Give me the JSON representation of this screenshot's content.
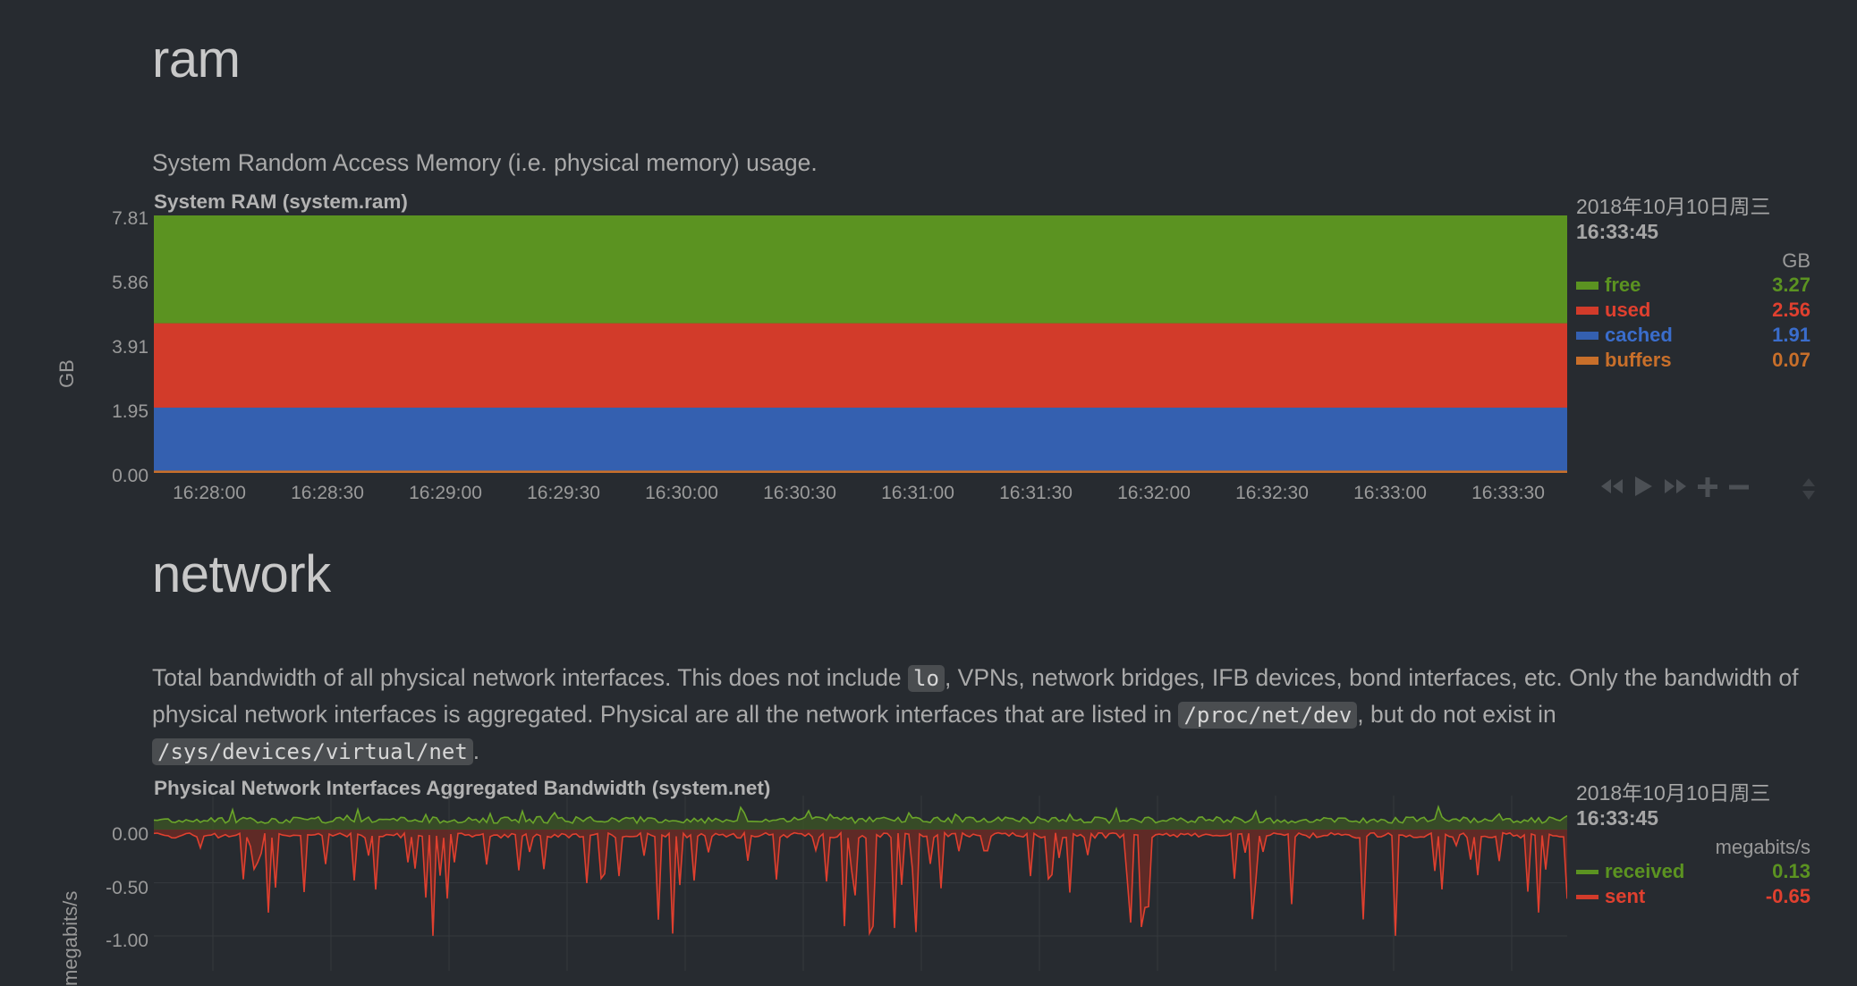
{
  "ram": {
    "heading": "ram",
    "description": "System Random Access Memory (i.e. physical memory) usage.",
    "chart_title": "System RAM (system.ram)",
    "y_unit": "GB",
    "y_ticks": [
      "7.81",
      "5.86",
      "3.91",
      "1.95",
      "0.00"
    ],
    "x_ticks": [
      "16:28:00",
      "16:28:30",
      "16:29:00",
      "16:29:30",
      "16:30:00",
      "16:30:30",
      "16:31:00",
      "16:31:30",
      "16:32:00",
      "16:32:30",
      "16:33:00",
      "16:33:30"
    ],
    "legend": {
      "date": "2018年10月10日周三",
      "time": "16:33:45",
      "units": "GB",
      "items": [
        {
          "name": "free",
          "value": "3.27",
          "color": "#5b9321"
        },
        {
          "name": "used",
          "value": "2.56",
          "color": "#d23b2a"
        },
        {
          "name": "cached",
          "value": "1.91",
          "color": "#3460b0"
        },
        {
          "name": "buffers",
          "value": "0.07",
          "color": "#c86f2a"
        }
      ]
    }
  },
  "network": {
    "heading": "network",
    "desc_part1": "Total bandwidth of all physical network interfaces. This does not include ",
    "code_lo": "lo",
    "desc_part2": ", VPNs, network bridges, IFB devices, bond interfaces, etc. Only the bandwidth of physical network interfaces is aggregated. Physical are all the network interfaces that are listed in ",
    "code_proc": "/proc/net/dev",
    "desc_part3": ", but do not exist in ",
    "code_sys": "/sys/devices/virtual/net",
    "desc_part4": ".",
    "chart_title": "Physical Network Interfaces Aggregated Bandwidth (system.net)",
    "y_unit": "megabits/s",
    "y_ticks": [
      "0.00",
      "-0.50",
      "-1.00"
    ],
    "legend": {
      "date": "2018年10月10日周三",
      "time": "16:33:45",
      "units": "megabits/s",
      "items": [
        {
          "name": "received",
          "value": "0.13",
          "color": "#5b9321"
        },
        {
          "name": "sent",
          "value": "-0.65",
          "color": "#d23b2a"
        }
      ]
    }
  },
  "controls": [
    "rewind-icon",
    "play-icon",
    "fast-forward-icon",
    "zoom-in-icon",
    "zoom-out-icon",
    "resize-icon"
  ],
  "chart_data": [
    {
      "type": "area",
      "title": "System RAM (system.ram)",
      "ylabel": "GB",
      "ylim": [
        0,
        7.81
      ],
      "x": [
        "16:28:00",
        "16:28:30",
        "16:29:00",
        "16:29:30",
        "16:30:00",
        "16:30:30",
        "16:31:00",
        "16:31:30",
        "16:32:00",
        "16:32:30",
        "16:33:00",
        "16:33:30"
      ],
      "stacked": true,
      "series": [
        {
          "name": "buffers",
          "value": 0.07,
          "color": "#c86f2a"
        },
        {
          "name": "cached",
          "value": 1.91,
          "color": "#3460b0"
        },
        {
          "name": "used",
          "value": 2.56,
          "color": "#d23b2a"
        },
        {
          "name": "free",
          "value": 3.27,
          "color": "#5b9321"
        }
      ]
    },
    {
      "type": "area",
      "title": "Physical Network Interfaces Aggregated Bandwidth (system.net)",
      "ylabel": "megabits/s",
      "ylim": [
        -1.0,
        0.0
      ],
      "series": [
        {
          "name": "received",
          "color": "#5b9321",
          "baseline": 0.1
        },
        {
          "name": "sent",
          "color": "#d23b2a",
          "baseline": -0.05
        }
      ]
    }
  ]
}
